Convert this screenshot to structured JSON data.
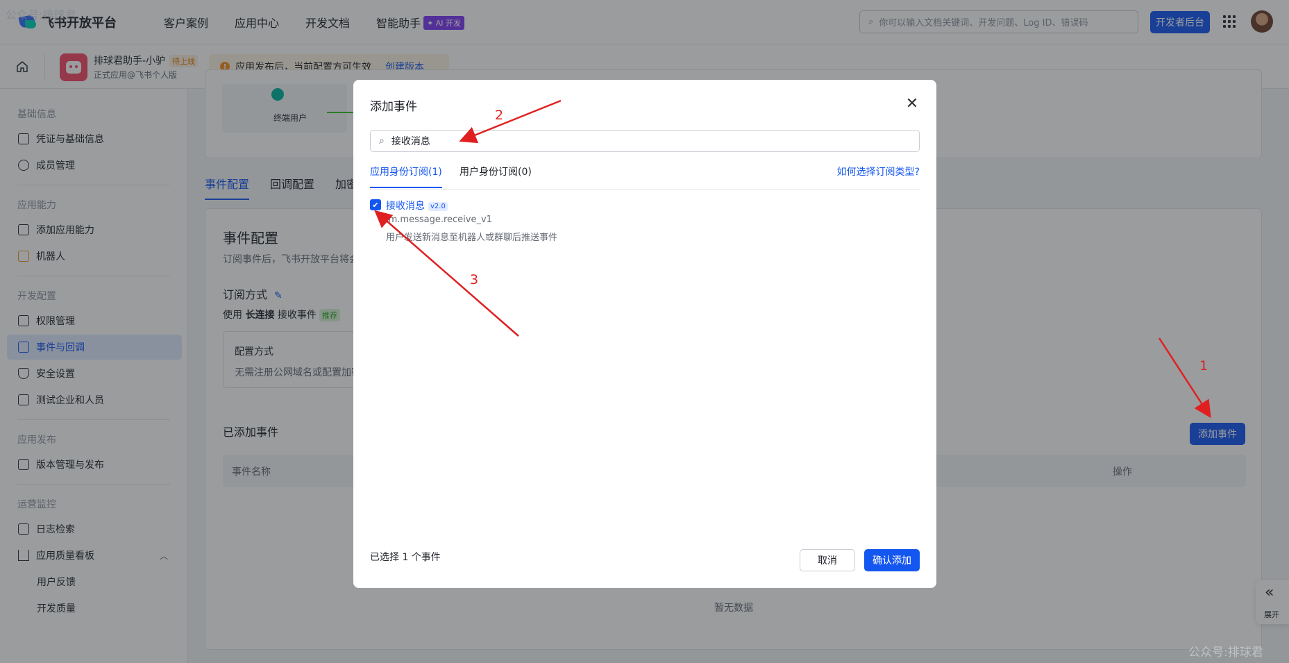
{
  "watermark": {
    "top": "公众号:排球君",
    "bottom": "公众号:排球君"
  },
  "topnav": {
    "logo": "飞书开放平台",
    "items": [
      "客户案例",
      "应用中心",
      "开发文档",
      "智能助手"
    ],
    "ai_badge": "✦ AI 开发",
    "search_placeholder": "你可以输入文档关键词、开发问题、Log ID、错误码",
    "dev_console": "开发者后台"
  },
  "appbar": {
    "app_name": "排球君助手-小驴",
    "app_status": "待上线",
    "app_sub": "正式应用@飞书个人版",
    "notice": "应用发布后，当前配置方可生效",
    "notice_link": "创建版本"
  },
  "sidebar": {
    "sections": [
      {
        "title": "基础信息",
        "items": [
          "凭证与基础信息",
          "成员管理"
        ]
      },
      {
        "title": "应用能力",
        "items": [
          "添加应用能力",
          "机器人"
        ]
      },
      {
        "title": "开发配置",
        "items": [
          "权限管理",
          "事件与回调",
          "安全设置",
          "测试企业和人员"
        ]
      },
      {
        "title": "应用发布",
        "items": [
          "版本管理与发布"
        ]
      },
      {
        "title": "运营监控",
        "items": [
          "日志检索",
          "应用质量看板",
          "用户反馈",
          "开发质量"
        ]
      }
    ],
    "active": "事件与回调"
  },
  "main": {
    "diagram_label": "终端用户",
    "tabs": [
      "事件配置",
      "回调配置",
      "加密"
    ],
    "title": "事件配置",
    "desc": "订阅事件后，飞书开放平台将会",
    "mode_title": "订阅方式",
    "use_prefix": "使用",
    "use_bold": "长连接",
    "use_suffix": "接收事件",
    "recommend": "推荐",
    "cfg_title": "配置方式",
    "cfg_desc": "无需注册公网域名或配置加密",
    "added_title": "已添加事件",
    "add_button": "添加事件",
    "table_headers": [
      "事件名称",
      "操作"
    ],
    "empty": "暂无数据"
  },
  "modal": {
    "title": "添加事件",
    "search_value": "接收消息",
    "tabs": [
      "应用身份订阅(1)",
      "用户身份订阅(0)"
    ],
    "help_link": "如何选择订阅类型?",
    "event": {
      "name": "接收消息",
      "version": "v2.0",
      "key": "im.message.receive_v1",
      "desc": "用户发送新消息至机器人或群聊后推送事件",
      "checked": true
    },
    "selected_count": "已选择 1 个事件",
    "cancel": "取消",
    "confirm": "确认添加"
  },
  "expand_widget": {
    "label": "展开"
  },
  "annotations": [
    "1",
    "2",
    "3"
  ],
  "colors": {
    "accent": "#1456f0",
    "annotation": "#e02020"
  }
}
